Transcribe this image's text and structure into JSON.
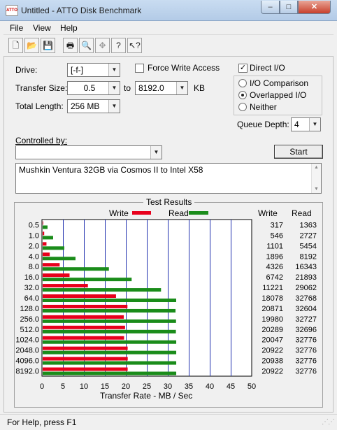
{
  "window": {
    "title": "Untitled - ATTO Disk Benchmark",
    "minimize_glyph": "–",
    "maximize_glyph": "□",
    "close_glyph": "✕"
  },
  "menu": [
    "File",
    "View",
    "Help"
  ],
  "toolbar": {
    "icons": [
      "new-icon",
      "open-icon",
      "save-icon",
      "print-icon",
      "print-preview-icon",
      "move-icon",
      "help-icon",
      "context-help-icon"
    ],
    "glyphs": [
      "🗋",
      "📂",
      "💾",
      "🖶",
      "🔍",
      "✥",
      "?",
      "↖?"
    ]
  },
  "form": {
    "drive_label": "Drive:",
    "drive_value": "[-f-]",
    "force_write_label": "Force Write Access",
    "force_write_checked": false,
    "direct_io_label": "Direct I/O",
    "direct_io_checked": true,
    "transfer_size_label": "Transfer Size:",
    "transfer_from": "0.5",
    "to_label": "to",
    "transfer_to": "8192.0",
    "kb_label": "KB",
    "total_length_label": "Total Length:",
    "total_length_value": "256 MB",
    "io_options": [
      {
        "label": "I/O Comparison",
        "selected": false
      },
      {
        "label": "Overlapped I/O",
        "selected": true
      },
      {
        "label": "Neither",
        "selected": false
      }
    ],
    "queue_depth_label": "Queue Depth:",
    "queue_depth_value": "4",
    "controlled_by_label": "Controlled by:",
    "controlled_by_value": "",
    "start_label": "Start",
    "description": "Mushkin Ventura 32GB via Cosmos II to Intel X58"
  },
  "results": {
    "group_title": "Test Results",
    "legend_write": "Write",
    "legend_read": "Read",
    "col_write": "Write",
    "col_read": "Read",
    "write_color": "#e8001c",
    "read_color": "#1a8c1a",
    "grid_color": "#1f2fae"
  },
  "chart_data": {
    "type": "bar",
    "orientation": "horizontal",
    "categories": [
      "0.5",
      "1.0",
      "2.0",
      "4.0",
      "8.0",
      "16.0",
      "32.0",
      "64.0",
      "128.0",
      "256.0",
      "512.0",
      "1024.0",
      "2048.0",
      "4096.0",
      "8192.0"
    ],
    "series": [
      {
        "name": "Write",
        "values": [
          317,
          546,
          1101,
          1896,
          4326,
          6742,
          11221,
          18078,
          20871,
          19980,
          20289,
          20047,
          20922,
          20938,
          20922
        ]
      },
      {
        "name": "Read",
        "values": [
          1363,
          2727,
          5454,
          8192,
          16343,
          21893,
          29062,
          32768,
          32604,
          32727,
          32696,
          32776,
          32776,
          32776,
          32776
        ]
      }
    ],
    "xlabel": "Transfer Rate - MB / Sec",
    "xlim": [
      0,
      50
    ],
    "xticks": [
      "0",
      "5",
      "10",
      "15",
      "20",
      "25",
      "30",
      "35",
      "40",
      "45",
      "50"
    ],
    "grid": true,
    "legend": "top"
  },
  "status": {
    "text": "For Help, press F1"
  }
}
